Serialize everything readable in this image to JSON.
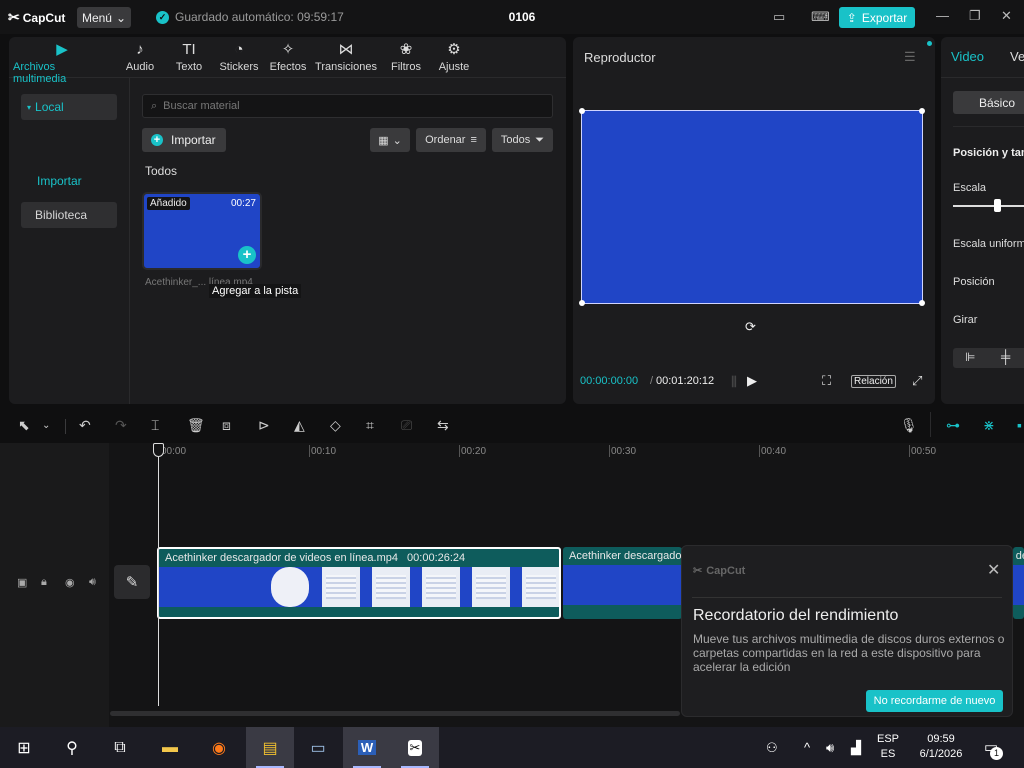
{
  "titlebar": {
    "logo": "CapCut",
    "menu_label": "Menú",
    "autosave_text": "Guardado automático: 09:59:17",
    "project_name": "0106",
    "export_label": "Exportar"
  },
  "media_tabs": [
    {
      "label": "Archivos multimedia",
      "icon": "media-icon",
      "active": true
    },
    {
      "label": "Audio",
      "icon": "audio-icon"
    },
    {
      "label": "Texto",
      "icon": "text-icon"
    },
    {
      "label": "Stickers",
      "icon": "sticker-icon"
    },
    {
      "label": "Efectos",
      "icon": "effects-icon"
    },
    {
      "label": "Transiciones",
      "icon": "transition-icon"
    },
    {
      "label": "Filtros",
      "icon": "filter-icon"
    },
    {
      "label": "Ajuste",
      "icon": "adjust-icon"
    }
  ],
  "sidebar": {
    "local": "Local",
    "import": "Importar",
    "library": "Biblioteca"
  },
  "media": {
    "search_placeholder": "Buscar material",
    "import_label": "Importar",
    "sort_label": "Ordenar",
    "filter_label": "Todos",
    "section": "Todos",
    "item": {
      "badge": "Añadido",
      "duration": "00:27",
      "name": "Acethinker_... línea.mp4",
      "tooltip": "Agregar a la pista"
    }
  },
  "player": {
    "title": "Reproductor",
    "current_time": "00:00:00:00",
    "total_time": "00:01:20:12",
    "ratio_label": "Relación"
  },
  "props": {
    "tab_video": "Video",
    "tab_speed": "Ve",
    "basic": "Básico",
    "section": "Posición y tamaño",
    "scale": "Escala",
    "uniform_scale": "Escala uniforme",
    "position": "Posición",
    "rotate": "Girar"
  },
  "timeline": {
    "ruler": [
      "00:00",
      "00:10",
      "00:20",
      "00:30",
      "00:40",
      "00:50"
    ],
    "clip1_title": "Acethinker descargador de videos en línea.mp4",
    "clip1_duration": "00:00:26:24",
    "clip2_title": "Acethinker descargador de",
    "clip3_title": "r de"
  },
  "notification": {
    "brand": "CapCut",
    "title": "Recordatorio del rendimiento",
    "body": "Mueve tus archivos multimedia de discos duros externos o carpetas compartidas en la red a este dispositivo para acelerar la edición",
    "button": "No recordarme de nuevo"
  },
  "taskbar": {
    "lang_line1": "ESP",
    "lang_line2": "ES",
    "time": "09:59",
    "date": "6/1/2026",
    "notif_count": "1"
  },
  "colors": {
    "accent": "#19c2c8",
    "preview_blue": "#2045c6",
    "clip_teal": "#0e5c5c"
  }
}
